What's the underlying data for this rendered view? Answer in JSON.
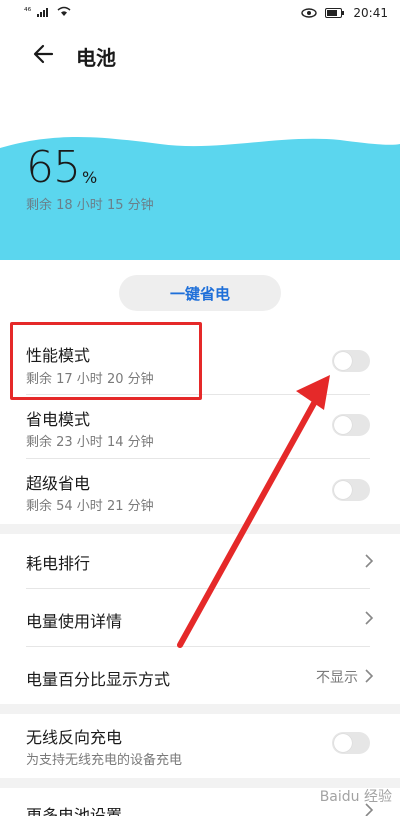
{
  "statusbar": {
    "signal_label": "⁴⁶",
    "time": "20:41"
  },
  "header": {
    "title": "电池"
  },
  "battery": {
    "percent": "65",
    "unit": "%",
    "remaining": "剩余 18 小时 15 分钟",
    "wave_color": "#5bd6ee"
  },
  "save_power_button": "一键省电",
  "modes": [
    {
      "title": "性能模式",
      "subtitle": "剩余 17 小时 20 分钟",
      "on": false
    },
    {
      "title": "省电模式",
      "subtitle": "剩余 23 小时 14 分钟",
      "on": false
    },
    {
      "title": "超级省电",
      "subtitle": "剩余 54 小时 21 分钟",
      "on": false
    }
  ],
  "list": {
    "power_ranking": "耗电排行",
    "usage_details": "电量使用详情",
    "percent_display": "电量百分比显示方式",
    "percent_display_value": "不显示"
  },
  "wireless": {
    "title": "无线反向充电",
    "subtitle": "为支持无线充电的设备充电",
    "on": false
  },
  "more": {
    "title": "更多电池设置"
  },
  "annotation": {
    "box_color": "#e52929",
    "arrow_color": "#e52929"
  },
  "watermark": "Baidu 经验"
}
